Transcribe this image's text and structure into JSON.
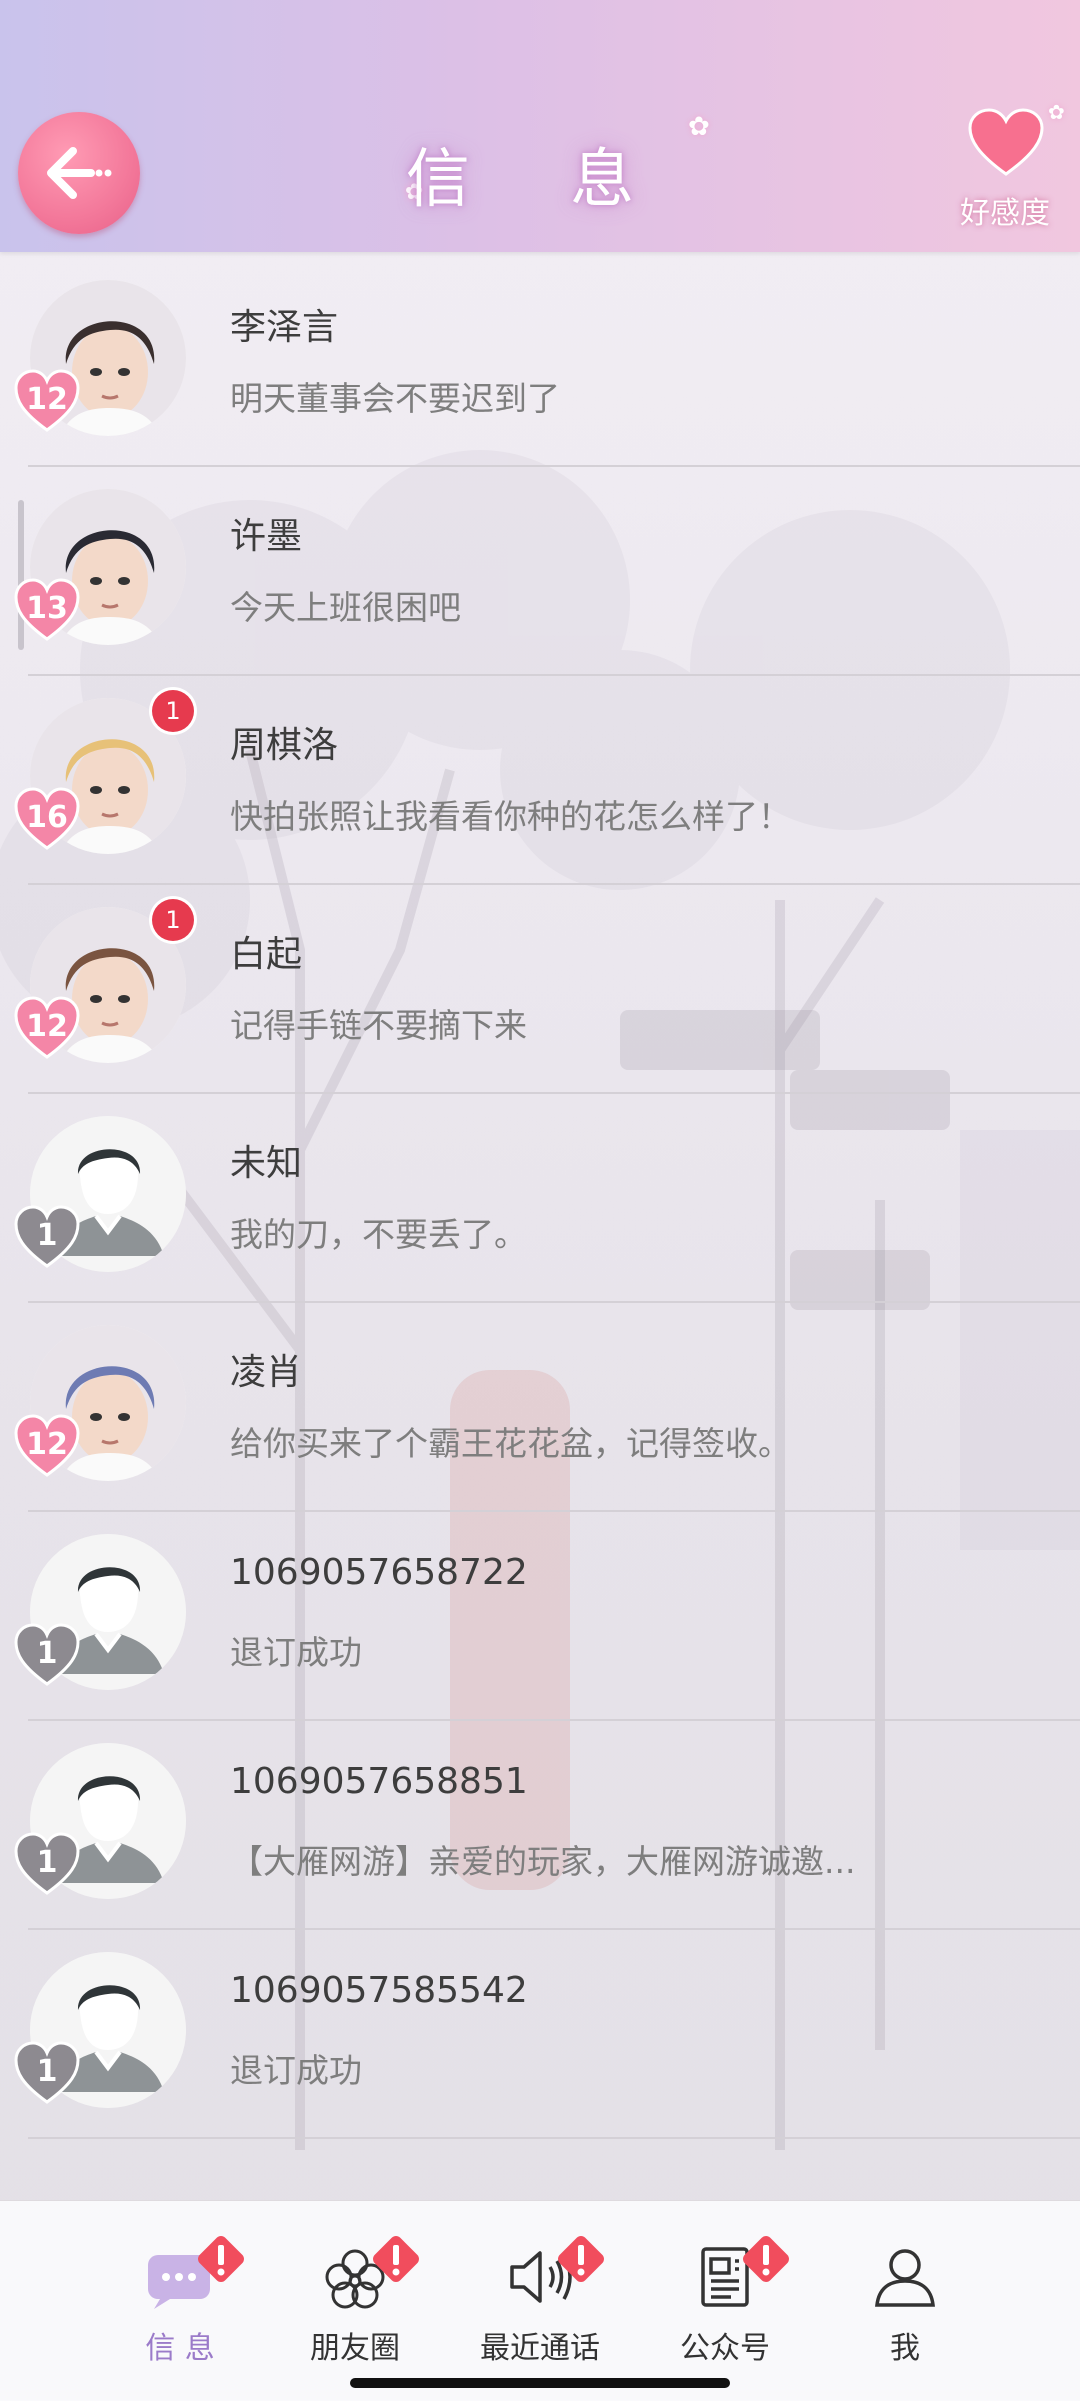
{
  "header": {
    "title": "信 息",
    "affinity_label": "好感度",
    "back_icon": "back-arrow-icon",
    "affinity_icon": "heart-icon"
  },
  "colors": {
    "accent_pink": "#f3789a",
    "badge_red": "#e63a4e",
    "active_tab": "#9b7bc9",
    "header_start": "#c9c3ec",
    "header_end": "#f1c7df"
  },
  "messages": [
    {
      "name": "李泽言",
      "preview": "明天董事会不要迟到了",
      "affinity": "12",
      "unread": null,
      "heart": "pink",
      "avatar": "character"
    },
    {
      "name": "许墨",
      "preview": "今天上班很困吧",
      "affinity": "13",
      "unread": null,
      "heart": "pink",
      "avatar": "character"
    },
    {
      "name": "周棋洛",
      "preview": "快拍张照让我看看你种的花怎么样了！",
      "affinity": "16",
      "unread": "1",
      "heart": "pink",
      "avatar": "character"
    },
    {
      "name": "白起",
      "preview": "记得手链不要摘下来",
      "affinity": "12",
      "unread": "1",
      "heart": "pink",
      "avatar": "character"
    },
    {
      "name": "未知",
      "preview": "我的刀，不要丢了。",
      "affinity": "1",
      "unread": null,
      "heart": "gray",
      "avatar": "placeholder"
    },
    {
      "name": "凌肖",
      "preview": "给你买来了个霸王花花盆，记得签收。",
      "affinity": "12",
      "unread": null,
      "heart": "pink",
      "avatar": "character"
    },
    {
      "name": "1069057658722",
      "preview": "退订成功",
      "affinity": "1",
      "unread": null,
      "heart": "gray",
      "avatar": "placeholder"
    },
    {
      "name": "1069057658851",
      "preview": "【大雁网游】亲爱的玩家，大雁网游诚邀...",
      "affinity": "1",
      "unread": null,
      "heart": "gray",
      "avatar": "placeholder"
    },
    {
      "name": "1069057585542",
      "preview": "退订成功",
      "affinity": "1",
      "unread": null,
      "heart": "gray",
      "avatar": "placeholder"
    }
  ],
  "tabs": [
    {
      "label": "信 息",
      "icon": "chat-bubble-icon",
      "active": true,
      "alert": true
    },
    {
      "label": "朋友圈",
      "icon": "flower-icon",
      "active": false,
      "alert": true
    },
    {
      "label": "最近通话",
      "icon": "speaker-icon",
      "active": false,
      "alert": true
    },
    {
      "label": "公众号",
      "icon": "newspaper-icon",
      "active": false,
      "alert": true
    },
    {
      "label": "我",
      "icon": "person-icon",
      "active": false,
      "alert": false
    }
  ]
}
